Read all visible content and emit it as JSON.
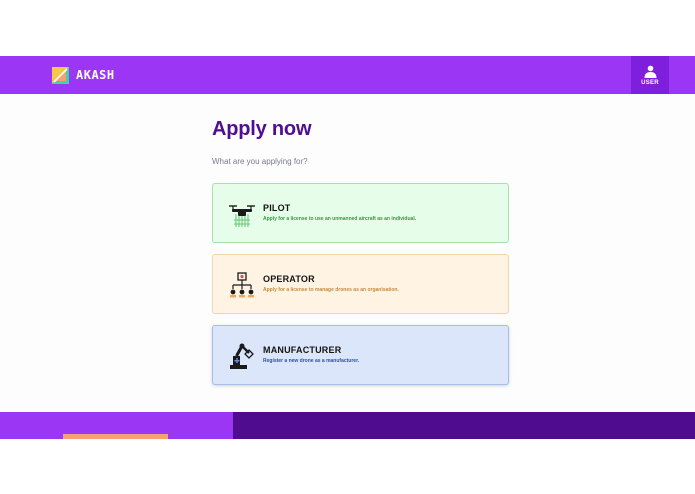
{
  "header": {
    "brand": "AKASH",
    "user_label": "USER",
    "brand_color": "#9b36f5",
    "user_button_color": "#7d1fdc"
  },
  "main": {
    "title": "Apply now",
    "subtitle": "What are you applying for?",
    "options": [
      {
        "title": "PILOT",
        "description": "Apply for a license to use an unmanned aircraft as an individual.",
        "icon": "drone-icon",
        "background": "#e6fde9"
      },
      {
        "title": "OPERATOR",
        "description": "Apply for a license to manage drones as an organisation.",
        "icon": "org-chart-icon",
        "background": "#fff4e4"
      },
      {
        "title": "MANUFACTURER",
        "description": "Register a new drone as a manufacturer.",
        "icon": "robot-arm-icon",
        "background": "#dce6fb"
      }
    ]
  },
  "footer": {
    "left_color": "#9b36f5",
    "right_color": "#4f0c8e",
    "accent_color": "#f6a171"
  }
}
